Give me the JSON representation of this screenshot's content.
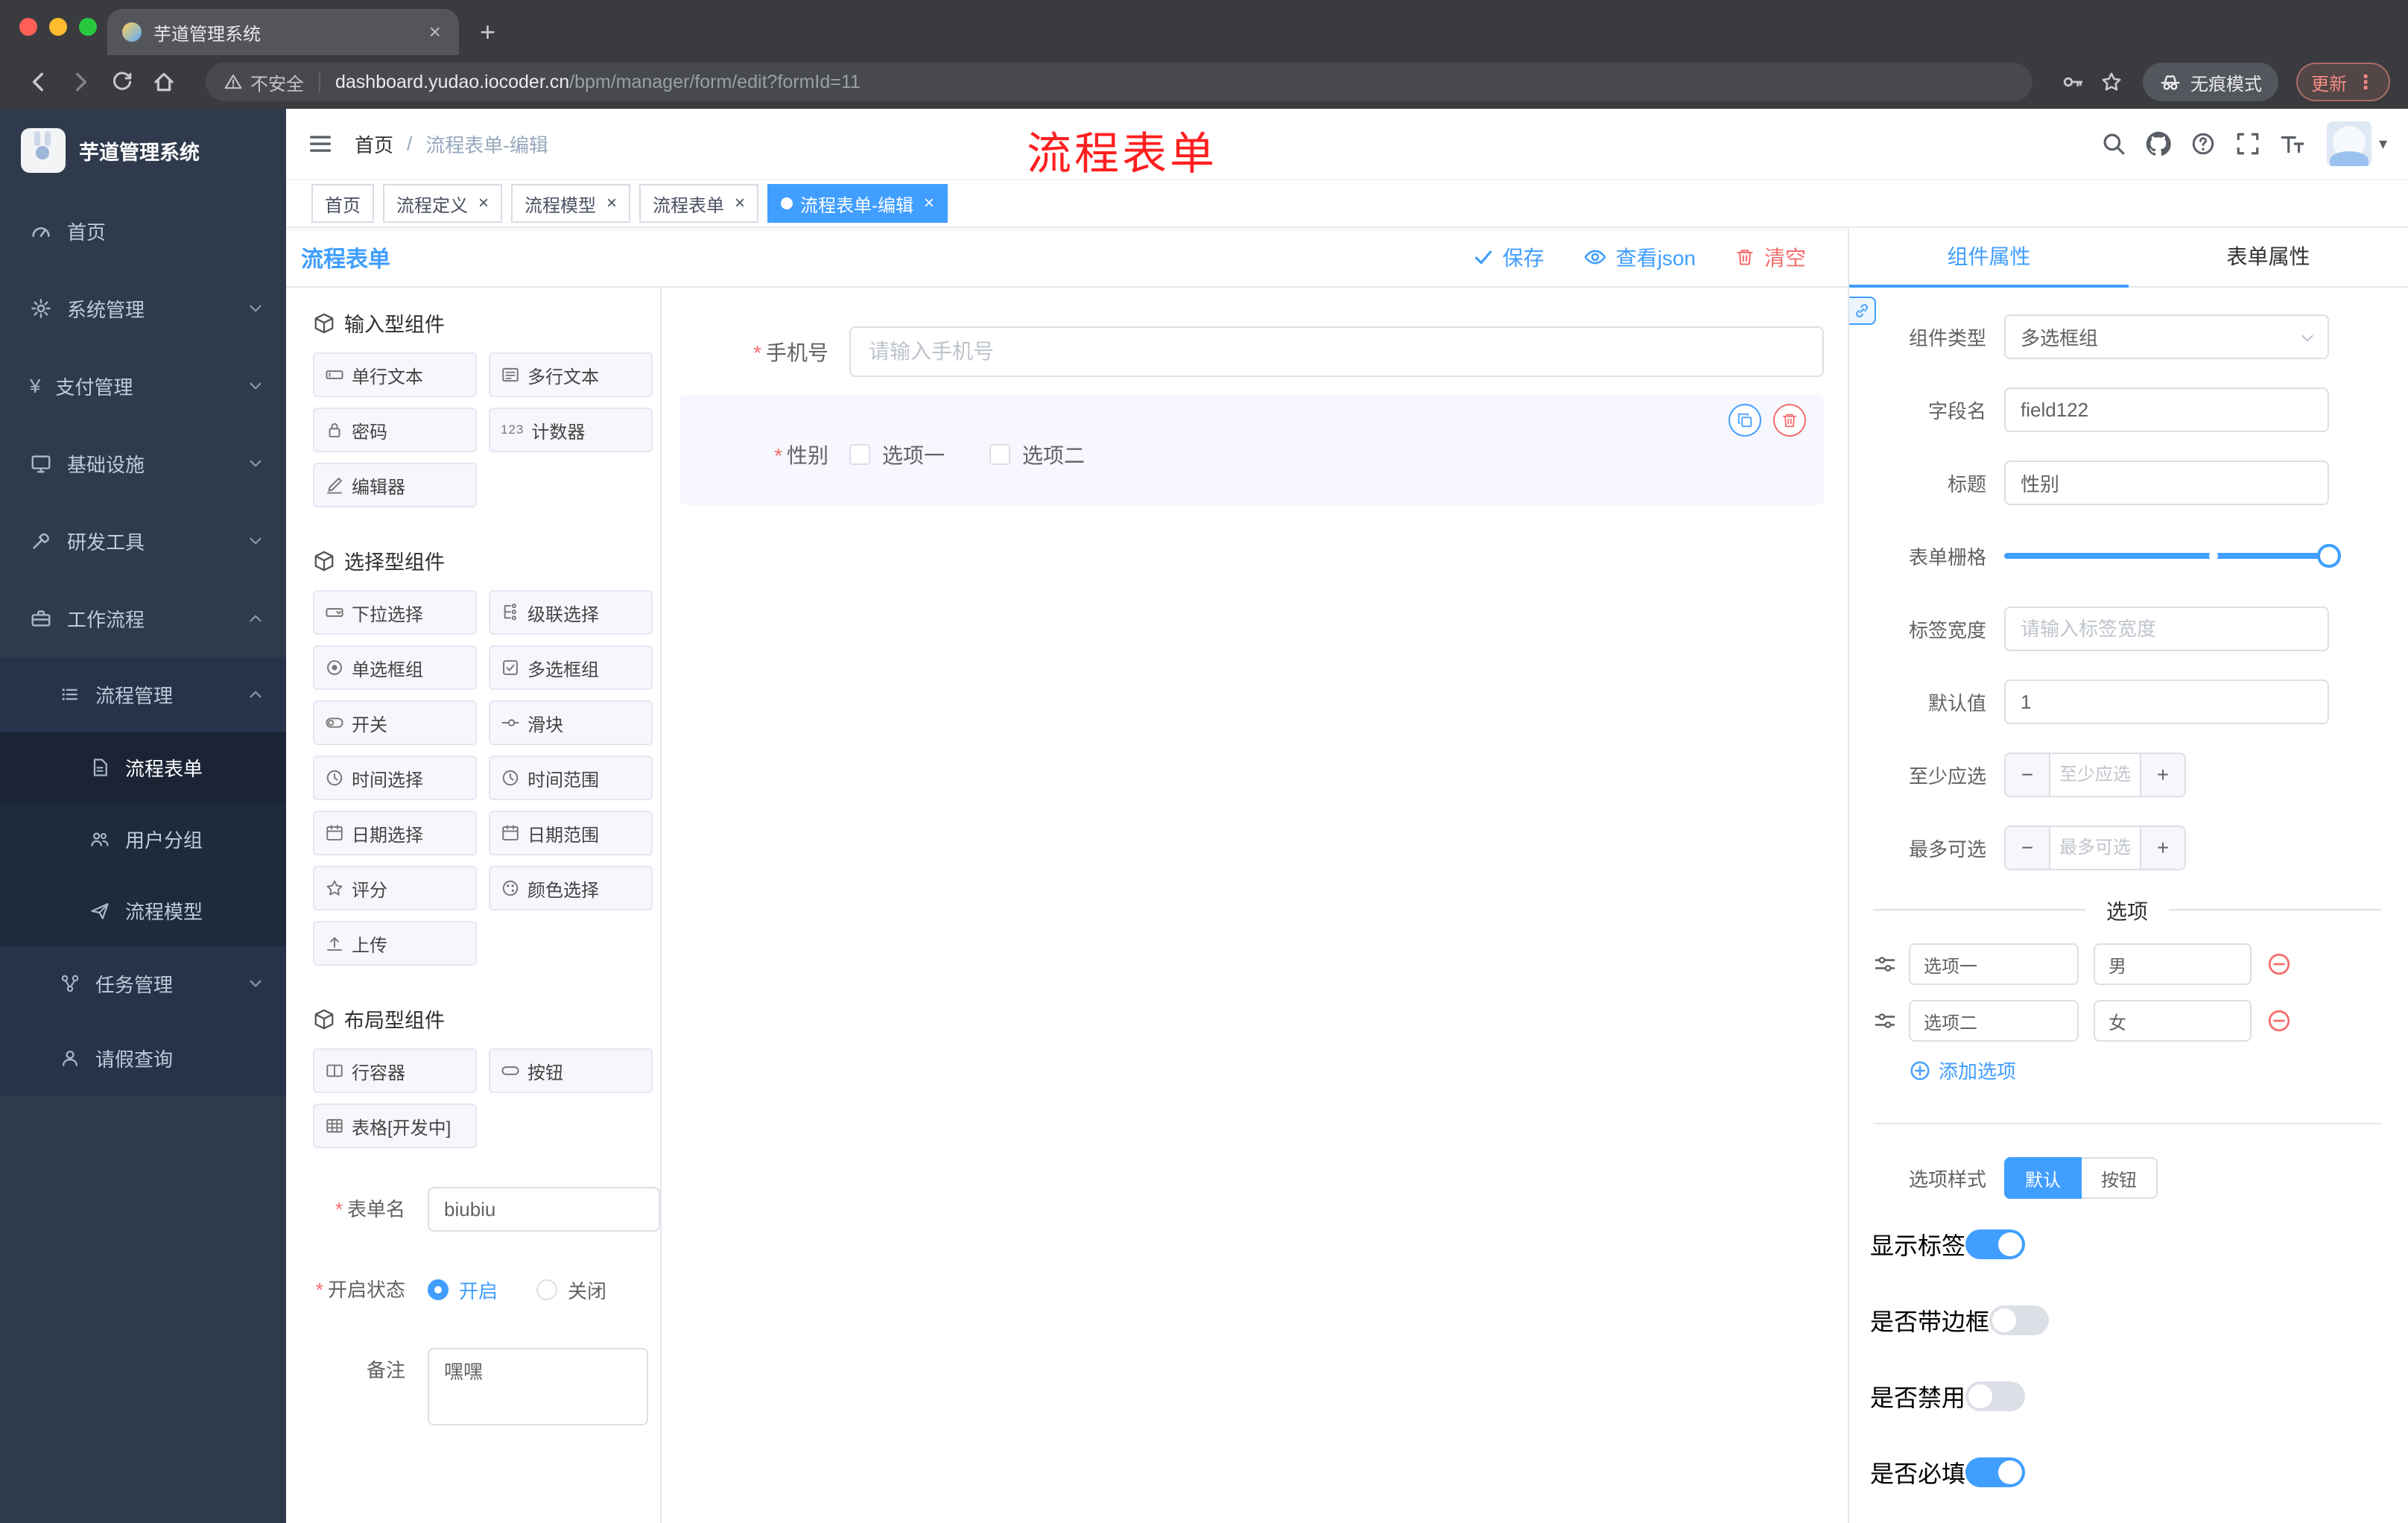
{
  "icons": {
    "close": "×",
    "new_tab": "+",
    "kebab": "⋮",
    "caret_down": "▾",
    "required_mark": "*",
    "counter": "123",
    "breadcrumb_sep": "/",
    "yen": "¥",
    "minus": "−",
    "plus": "+"
  },
  "browser": {
    "tab_title": "芋道管理系统",
    "security_label": "不安全",
    "url_domain": "dashboard.yudao.iocoder.cn",
    "url_path": "/bpm/manager/form/edit?formId=11",
    "incognito_label": "无痕模式",
    "update_label": "更新"
  },
  "sidebar": {
    "app_title": "芋道管理系统",
    "menu": [
      {
        "label": "首页"
      },
      {
        "label": "系统管理"
      },
      {
        "label": "支付管理"
      },
      {
        "label": "基础设施"
      },
      {
        "label": "研发工具"
      },
      {
        "label": "工作流程"
      },
      {
        "label": "流程管理"
      },
      {
        "label": "流程表单"
      },
      {
        "label": "用户分组"
      },
      {
        "label": "流程模型"
      },
      {
        "label": "任务管理"
      },
      {
        "label": "请假查询"
      }
    ]
  },
  "navbar": {
    "breadcrumb_home": "首页",
    "breadcrumb_current": "流程表单-编辑",
    "annotation": "流程表单"
  },
  "tags": [
    {
      "label": "首页"
    },
    {
      "label": "流程定义"
    },
    {
      "label": "流程模型"
    },
    {
      "label": "流程表单"
    },
    {
      "label": "流程表单-编辑"
    }
  ],
  "editor": {
    "panel_title": "流程表单",
    "actions": {
      "save": "保存",
      "view_json": "查看json",
      "clear": "清空"
    }
  },
  "palette": {
    "sections": [
      {
        "title": "输入型组件",
        "items": [
          {
            "label": "单行文本"
          },
          {
            "label": "多行文本"
          },
          {
            "label": "密码"
          },
          {
            "label": "计数器"
          },
          {
            "label": "编辑器"
          }
        ]
      },
      {
        "title": "选择型组件",
        "items": [
          {
            "label": "下拉选择"
          },
          {
            "label": "级联选择"
          },
          {
            "label": "单选框组"
          },
          {
            "label": "多选框组"
          },
          {
            "label": "开关"
          },
          {
            "label": "滑块"
          },
          {
            "label": "时间选择"
          },
          {
            "label": "时间范围"
          },
          {
            "label": "日期选择"
          },
          {
            "label": "日期范围"
          },
          {
            "label": "评分"
          },
          {
            "label": "颜色选择"
          },
          {
            "label": "上传"
          }
        ]
      },
      {
        "title": "布局型组件",
        "items": [
          {
            "label": "行容器"
          },
          {
            "label": "按钮"
          },
          {
            "label": "表格[开发中]"
          }
        ]
      }
    ],
    "form": {
      "name_label": "表单名",
      "name_value": "biubiu",
      "status_label": "开启状态",
      "status_on": "开启",
      "status_off": "关闭",
      "remark_label": "备注",
      "remark_value": "嘿嘿"
    }
  },
  "canvas": {
    "phone": {
      "label": "手机号",
      "placeholder": "请输入手机号"
    },
    "gender": {
      "label": "性别",
      "options": [
        "选项一",
        "选项二"
      ]
    }
  },
  "props": {
    "tabs": {
      "component": "组件属性",
      "form": "表单属性"
    },
    "component_type": {
      "label": "组件类型",
      "value": "多选框组"
    },
    "field_name": {
      "label": "字段名",
      "value": "field122"
    },
    "title": {
      "label": "标题",
      "value": "性别"
    },
    "grid": {
      "label": "表单栅格"
    },
    "label_width": {
      "label": "标签宽度",
      "placeholder": "请输入标签宽度"
    },
    "default_value": {
      "label": "默认值",
      "value": "1"
    },
    "min_select": {
      "label": "至少应选",
      "placeholder": "至少应选"
    },
    "max_select": {
      "label": "最多可选",
      "placeholder": "最多可选"
    },
    "options_divider": "选项",
    "options": [
      {
        "label": "选项一",
        "value": "男"
      },
      {
        "label": "选项二",
        "value": "女"
      }
    ],
    "add_option": "添加选项",
    "option_style": {
      "label": "选项样式",
      "default": "默认",
      "button": "按钮",
      "selected": "默认"
    },
    "toggles": [
      {
        "label": "显示标签",
        "on": true
      },
      {
        "label": "是否带边框",
        "on": false
      },
      {
        "label": "是否禁用",
        "on": false
      },
      {
        "label": "是否必填",
        "on": true
      }
    ]
  }
}
